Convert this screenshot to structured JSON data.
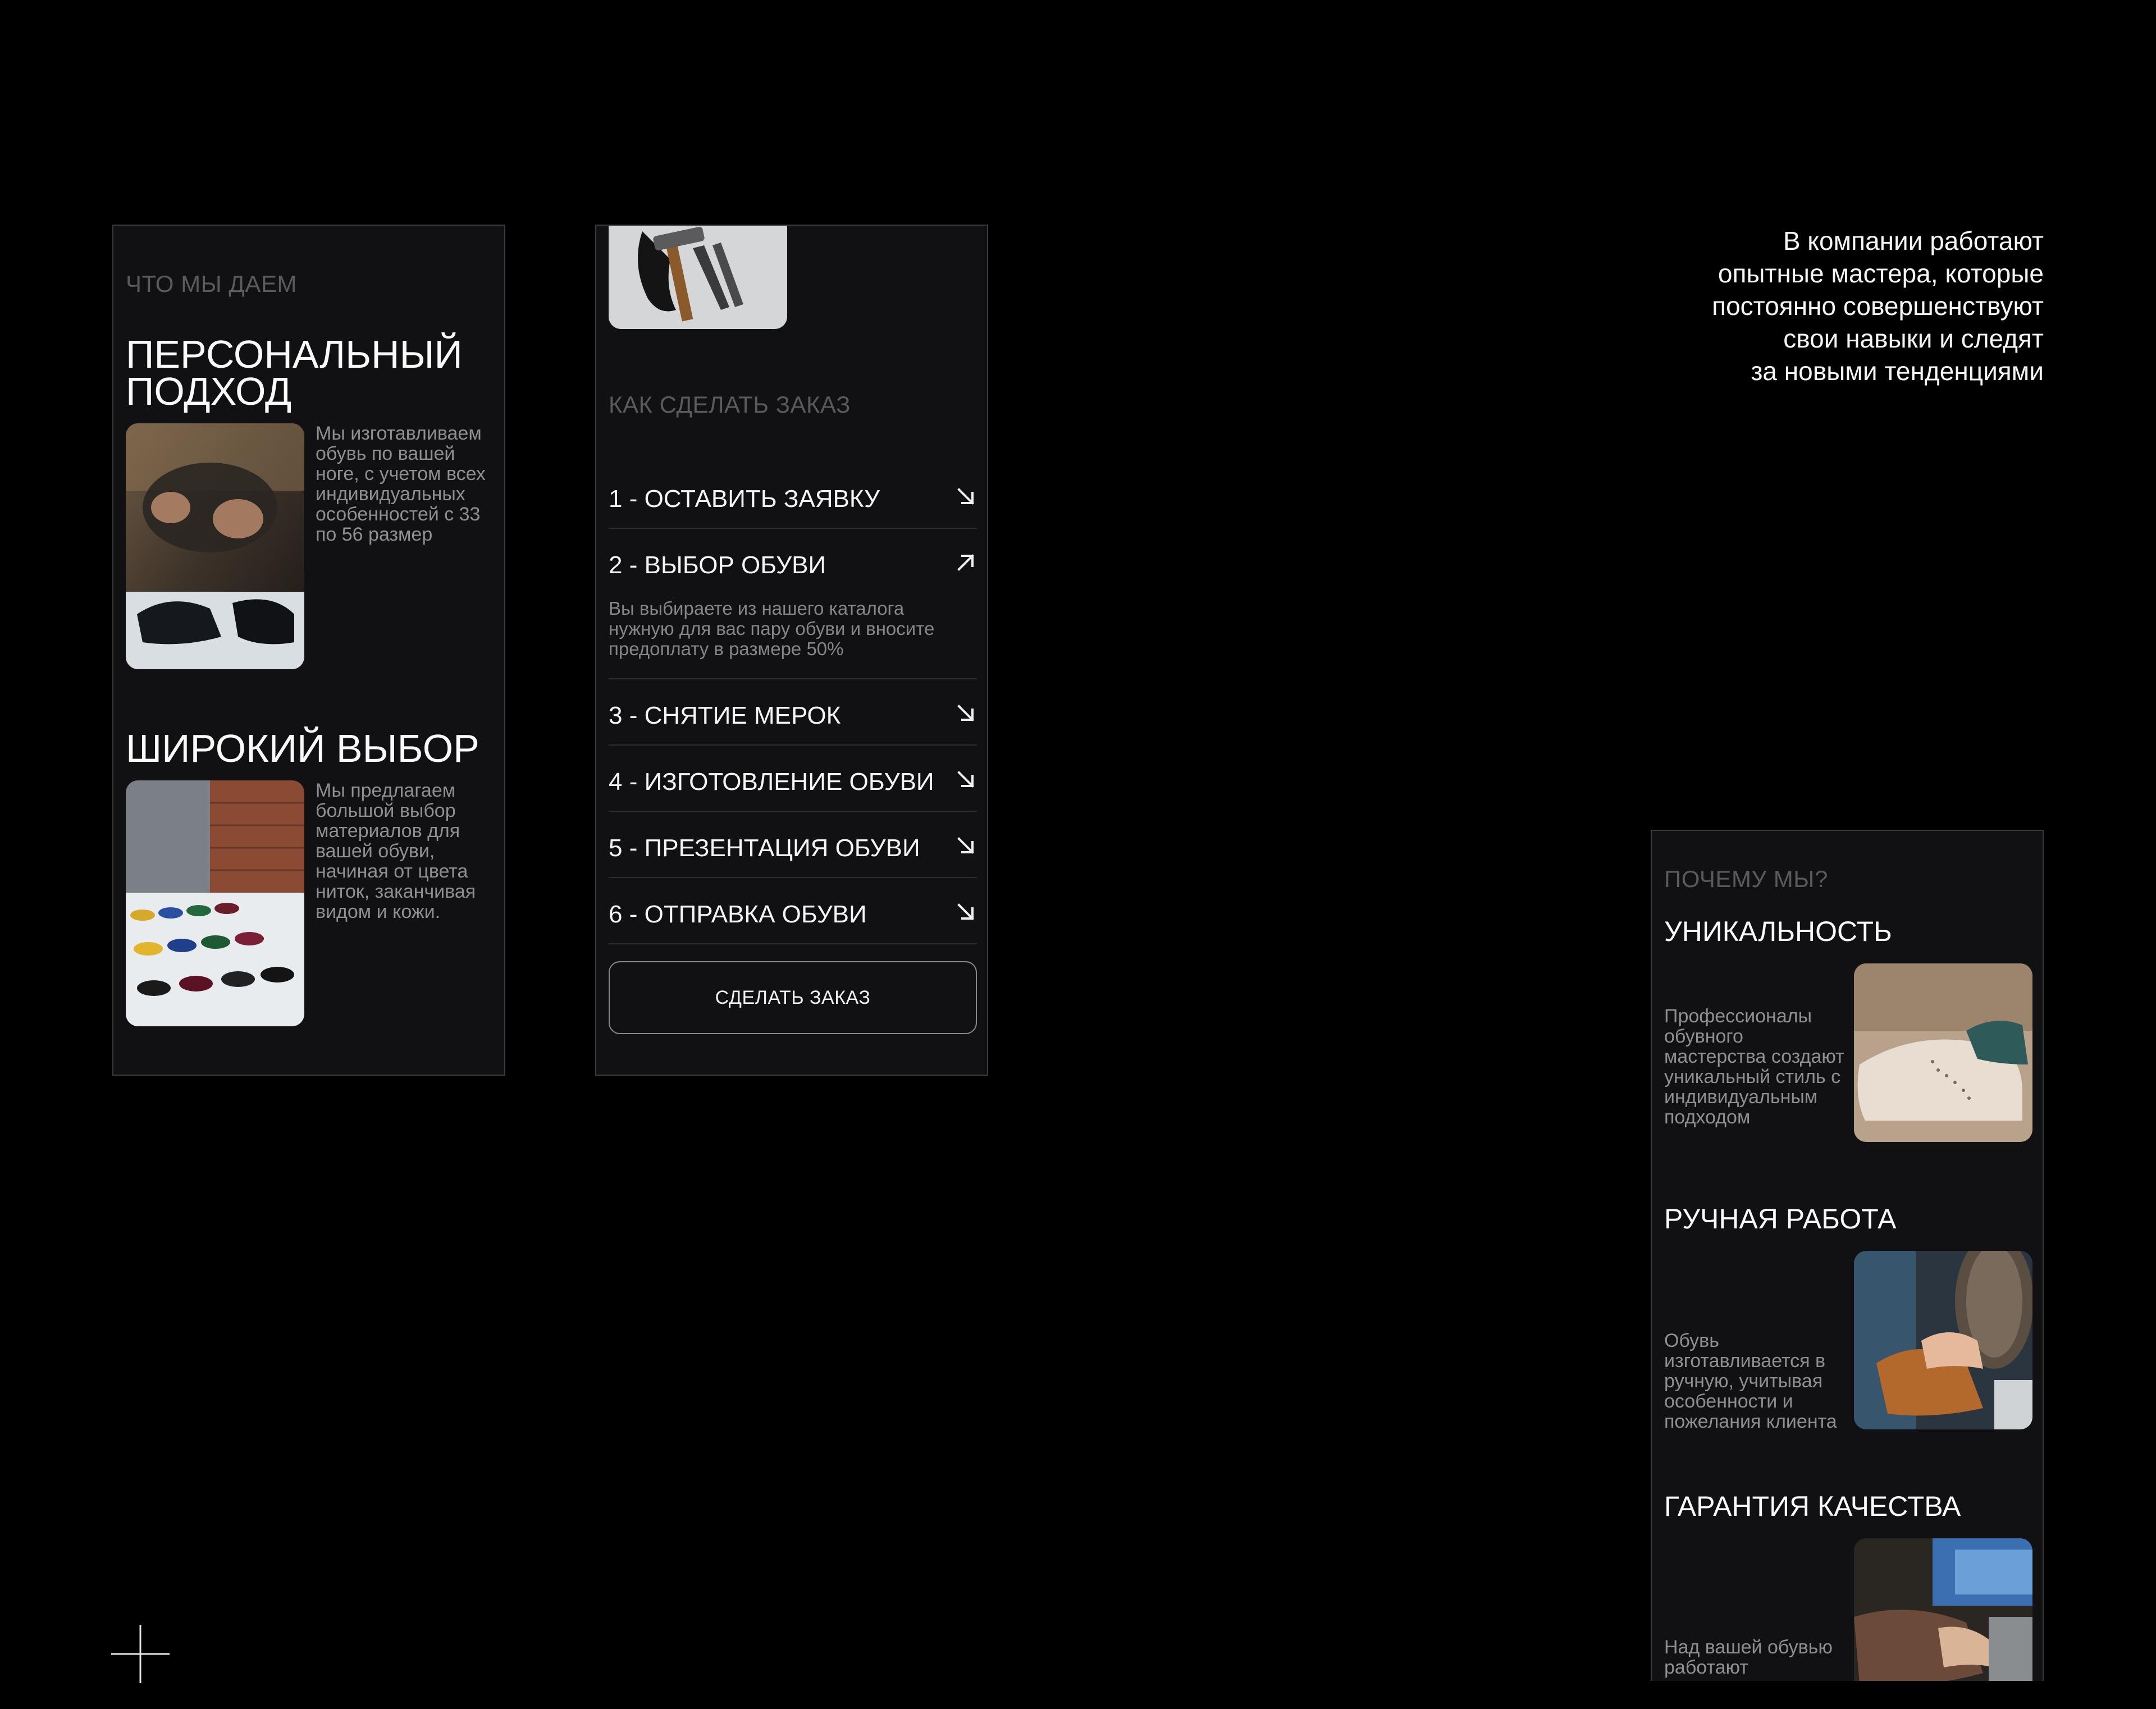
{
  "offer_card": {
    "section_label": "ЧТО МЫ ДАЕМ",
    "features": [
      {
        "title_line1": "ПЕРСОНАЛЬНЫЙ",
        "title_line2": "ПОДХОД",
        "description": "Мы изготавливаем обувь по вашей ноге, с учетом всех индивидуальных особенностей с 33 по 56 размер"
      },
      {
        "title_line1": "ШИРОКИЙ ВЫБОР",
        "description": "Мы предлагаем большой выбор материалов для вашей обуви, начиная от цвета ниток, заканчивая видом и кожи."
      }
    ]
  },
  "order_card": {
    "section_label": "КАК СДЕЛАТЬ ЗАКАЗ",
    "steps": [
      {
        "label": "1 - ОСТАВИТЬ ЗАЯВКУ",
        "expanded": false
      },
      {
        "label": "2 - ВЫБОР ОБУВИ",
        "expanded": true,
        "description": "Вы выбираете из нашего каталога нужную для вас пару обуви и вносите предоплату в размере 50%"
      },
      {
        "label": "3 - СНЯТИЕ МЕРОК",
        "expanded": false
      },
      {
        "label": "4 - ИЗГОТОВЛЕНИЕ ОБУВИ",
        "expanded": false
      },
      {
        "label": "5 - ПРЕЗЕНТАЦИЯ ОБУВИ",
        "expanded": false
      },
      {
        "label": "6 - ОТПРАВКА ОБУВИ",
        "expanded": false
      }
    ],
    "button_label": "СДЕЛАТЬ ЗАКАЗ"
  },
  "quote": {
    "lines": [
      "В компании работают",
      "опытные мастера, которые",
      "постоянно совершенствуют",
      "свои навыки и следят",
      "за новыми тенденциями"
    ]
  },
  "why_card": {
    "section_label": "ПОЧЕМУ МЫ?",
    "features": [
      {
        "title": "УНИКАЛЬНОСТЬ",
        "description": "Профессионалы обувного мастерства создают уникальный стиль с индивидуальным подходом"
      },
      {
        "title": "РУЧНАЯ РАБОТА",
        "description": "Обувь изготавливается в ручную, учитывая особенности и пожелания клиента"
      },
      {
        "title": "ГАРАНТИЯ КАЧЕСТВА",
        "description": "Над вашей обувью работают"
      }
    ]
  },
  "icons": {
    "arrow_collapsed": "arrow-down-right-icon",
    "arrow_expanded": "arrow-up-right-icon",
    "crosshair": "plus-crosshair-icon"
  },
  "colors": {
    "background": "#000000",
    "panel": "#111113",
    "panel_border": "#3a3a3d",
    "muted_label": "#5a5a5e",
    "body_text": "#8f8f93",
    "heading": "#fafafa"
  }
}
